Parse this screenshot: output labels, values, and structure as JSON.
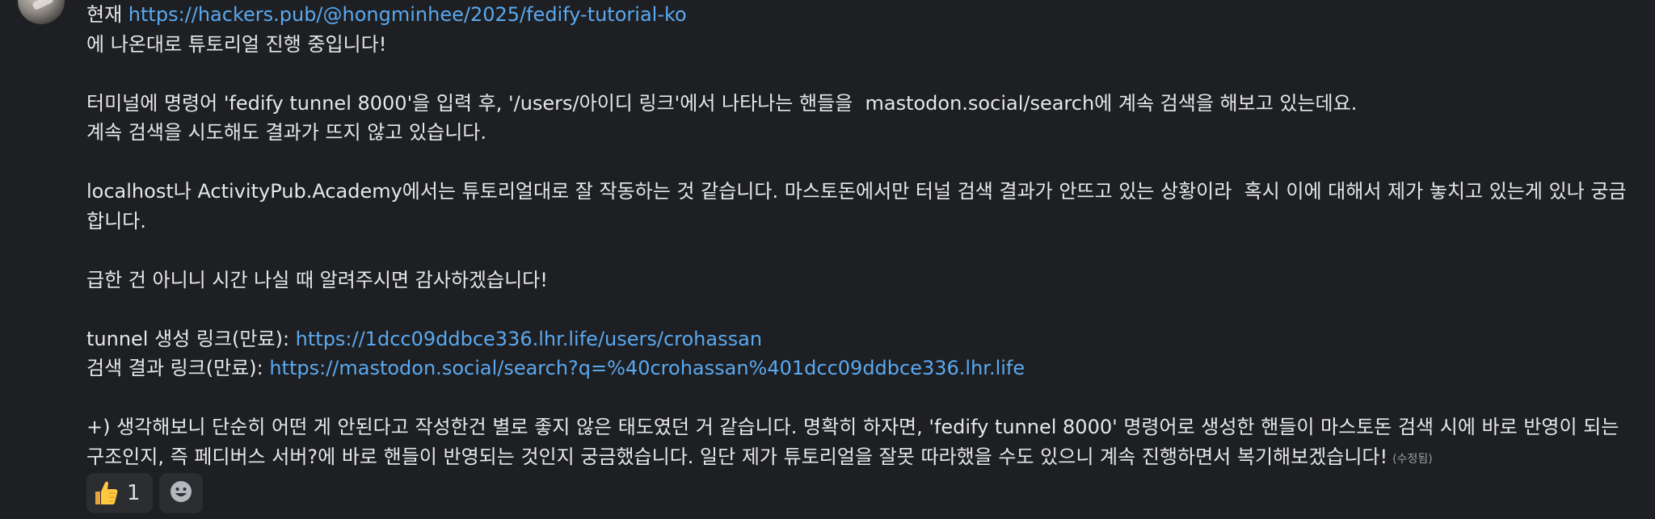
{
  "message": {
    "first_line_prefix": "현재 ",
    "tutorial_link": "https://hackers.pub/@hongminhee/2025/fedify-tutorial-ko",
    "line2": "에 나온대로 튜토리얼 진행 중입니다!",
    "line3": "터미널에 명령어 'fedify tunnel 8000'을 입력 후, '/users/아이디 링크'에서 나타나는 핸들을  mastodon.social/search에 계속 검색을 해보고 있는데요.",
    "line4": "계속 검색을 시도해도 결과가 뜨지 않고 있습니다.",
    "line5": "localhost나 ActivityPub.Academy에서는 튜토리얼대로 잘 작동하는 것 같습니다. 마스토돈에서만 터널 검색 결과가 안뜨고 있는 상황이라  혹시 이에 대해서 제가 놓치고 있는게 있나 궁금",
    "line6": "합니다.",
    "line7": "급한 건 아니니 시간 나실 때 알려주시면 감사하겠습니다!",
    "tunnel_label": "tunnel 생성 링크(만료): ",
    "tunnel_link": "https://1dcc09ddbce336.lhr.life/users/crohassan",
    "search_label": "검색 결과 링크(만료): ",
    "search_link": "https://mastodon.social/search?q=%40crohassan%401dcc09ddbce336.lhr.life",
    "line10": "+) 생각해보니 단순히 어떤 게 안된다고 작성한건 별로 좋지 않은 태도였던 거 같습니다. 명확히 하자면, 'fedify tunnel 8000' 명령어로 생성한 핸들이 마스토돈 검색 시에 바로 반영이 되는",
    "line11": "구조인지, 즉 페디버스 서버?에 바로 핸들이 반영되는 것인지 궁금했습니다. 일단 제가 튜토리얼을 잘못 따라했을 수도 있으니 계속 진행하면서 복기해보겠습니다!",
    "edited_label": "(수정됨)"
  },
  "reactions": [
    {
      "icon": "thumbs-up-icon",
      "count": "1"
    },
    {
      "icon": "add-reaction-smiley-icon"
    }
  ],
  "colors": {
    "background": "#1e1f22",
    "text": "#e6e7e9",
    "link": "#5aa9f0",
    "reaction_bg": "#2b2d31"
  }
}
